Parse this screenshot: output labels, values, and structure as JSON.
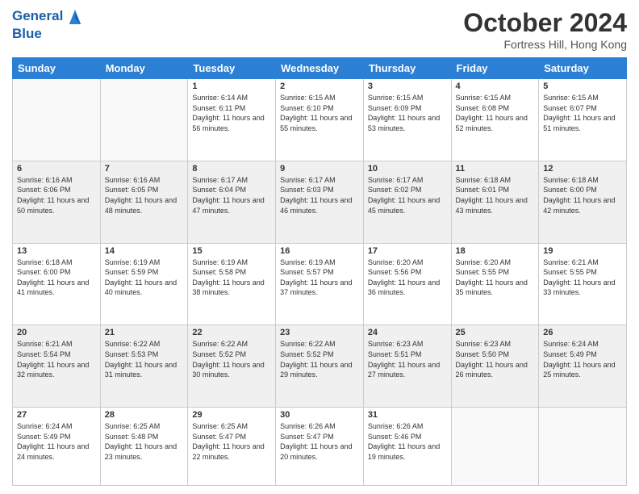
{
  "header": {
    "logo_line1": "General",
    "logo_line2": "Blue",
    "month_title": "October 2024",
    "location": "Fortress Hill, Hong Kong"
  },
  "weekdays": [
    "Sunday",
    "Monday",
    "Tuesday",
    "Wednesday",
    "Thursday",
    "Friday",
    "Saturday"
  ],
  "weeks": [
    [
      {
        "day": "",
        "info": ""
      },
      {
        "day": "",
        "info": ""
      },
      {
        "day": "1",
        "info": "Sunrise: 6:14 AM\nSunset: 6:11 PM\nDaylight: 11 hours and 56 minutes."
      },
      {
        "day": "2",
        "info": "Sunrise: 6:15 AM\nSunset: 6:10 PM\nDaylight: 11 hours and 55 minutes."
      },
      {
        "day": "3",
        "info": "Sunrise: 6:15 AM\nSunset: 6:09 PM\nDaylight: 11 hours and 53 minutes."
      },
      {
        "day": "4",
        "info": "Sunrise: 6:15 AM\nSunset: 6:08 PM\nDaylight: 11 hours and 52 minutes."
      },
      {
        "day": "5",
        "info": "Sunrise: 6:15 AM\nSunset: 6:07 PM\nDaylight: 11 hours and 51 minutes."
      }
    ],
    [
      {
        "day": "6",
        "info": "Sunrise: 6:16 AM\nSunset: 6:06 PM\nDaylight: 11 hours and 50 minutes."
      },
      {
        "day": "7",
        "info": "Sunrise: 6:16 AM\nSunset: 6:05 PM\nDaylight: 11 hours and 48 minutes."
      },
      {
        "day": "8",
        "info": "Sunrise: 6:17 AM\nSunset: 6:04 PM\nDaylight: 11 hours and 47 minutes."
      },
      {
        "day": "9",
        "info": "Sunrise: 6:17 AM\nSunset: 6:03 PM\nDaylight: 11 hours and 46 minutes."
      },
      {
        "day": "10",
        "info": "Sunrise: 6:17 AM\nSunset: 6:02 PM\nDaylight: 11 hours and 45 minutes."
      },
      {
        "day": "11",
        "info": "Sunrise: 6:18 AM\nSunset: 6:01 PM\nDaylight: 11 hours and 43 minutes."
      },
      {
        "day": "12",
        "info": "Sunrise: 6:18 AM\nSunset: 6:00 PM\nDaylight: 11 hours and 42 minutes."
      }
    ],
    [
      {
        "day": "13",
        "info": "Sunrise: 6:18 AM\nSunset: 6:00 PM\nDaylight: 11 hours and 41 minutes."
      },
      {
        "day": "14",
        "info": "Sunrise: 6:19 AM\nSunset: 5:59 PM\nDaylight: 11 hours and 40 minutes."
      },
      {
        "day": "15",
        "info": "Sunrise: 6:19 AM\nSunset: 5:58 PM\nDaylight: 11 hours and 38 minutes."
      },
      {
        "day": "16",
        "info": "Sunrise: 6:19 AM\nSunset: 5:57 PM\nDaylight: 11 hours and 37 minutes."
      },
      {
        "day": "17",
        "info": "Sunrise: 6:20 AM\nSunset: 5:56 PM\nDaylight: 11 hours and 36 minutes."
      },
      {
        "day": "18",
        "info": "Sunrise: 6:20 AM\nSunset: 5:55 PM\nDaylight: 11 hours and 35 minutes."
      },
      {
        "day": "19",
        "info": "Sunrise: 6:21 AM\nSunset: 5:55 PM\nDaylight: 11 hours and 33 minutes."
      }
    ],
    [
      {
        "day": "20",
        "info": "Sunrise: 6:21 AM\nSunset: 5:54 PM\nDaylight: 11 hours and 32 minutes."
      },
      {
        "day": "21",
        "info": "Sunrise: 6:22 AM\nSunset: 5:53 PM\nDaylight: 11 hours and 31 minutes."
      },
      {
        "day": "22",
        "info": "Sunrise: 6:22 AM\nSunset: 5:52 PM\nDaylight: 11 hours and 30 minutes."
      },
      {
        "day": "23",
        "info": "Sunrise: 6:22 AM\nSunset: 5:52 PM\nDaylight: 11 hours and 29 minutes."
      },
      {
        "day": "24",
        "info": "Sunrise: 6:23 AM\nSunset: 5:51 PM\nDaylight: 11 hours and 27 minutes."
      },
      {
        "day": "25",
        "info": "Sunrise: 6:23 AM\nSunset: 5:50 PM\nDaylight: 11 hours and 26 minutes."
      },
      {
        "day": "26",
        "info": "Sunrise: 6:24 AM\nSunset: 5:49 PM\nDaylight: 11 hours and 25 minutes."
      }
    ],
    [
      {
        "day": "27",
        "info": "Sunrise: 6:24 AM\nSunset: 5:49 PM\nDaylight: 11 hours and 24 minutes."
      },
      {
        "day": "28",
        "info": "Sunrise: 6:25 AM\nSunset: 5:48 PM\nDaylight: 11 hours and 23 minutes."
      },
      {
        "day": "29",
        "info": "Sunrise: 6:25 AM\nSunset: 5:47 PM\nDaylight: 11 hours and 22 minutes."
      },
      {
        "day": "30",
        "info": "Sunrise: 6:26 AM\nSunset: 5:47 PM\nDaylight: 11 hours and 20 minutes."
      },
      {
        "day": "31",
        "info": "Sunrise: 6:26 AM\nSunset: 5:46 PM\nDaylight: 11 hours and 19 minutes."
      },
      {
        "day": "",
        "info": ""
      },
      {
        "day": "",
        "info": ""
      }
    ]
  ]
}
